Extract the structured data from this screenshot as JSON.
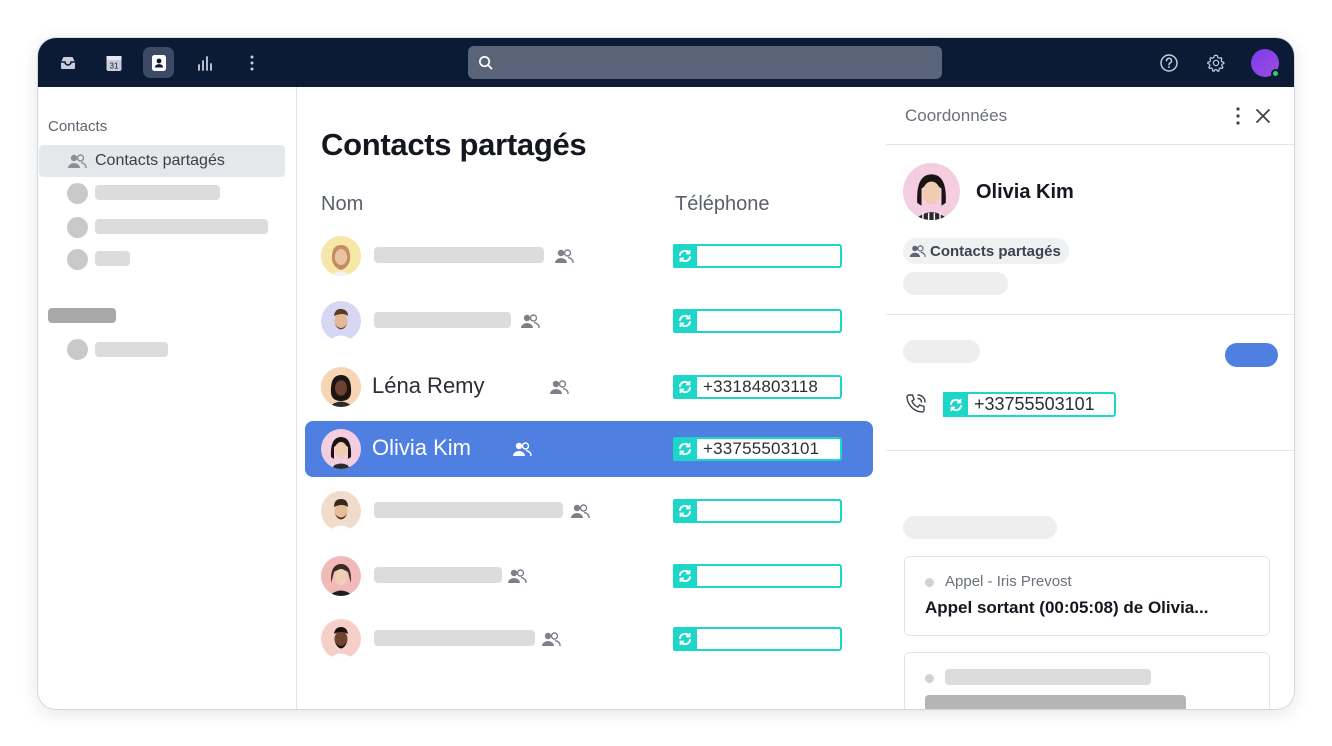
{
  "topbar": {
    "icons": [
      "inbox-icon",
      "calendar-icon",
      "contacts-icon",
      "analytics-icon",
      "more-vertical-icon"
    ],
    "calendar_day": "31",
    "search_placeholder": "",
    "help_icon": "help-icon",
    "settings_icon": "gear-icon"
  },
  "sidebar": {
    "heading": "Contacts",
    "active_item": "Contacts partagés"
  },
  "list": {
    "title": "Contacts partagés",
    "col_name": "Nom",
    "col_phone": "Téléphone",
    "rows": [
      {
        "name": "",
        "phone": "",
        "selected": false
      },
      {
        "name": "",
        "phone": "",
        "selected": false
      },
      {
        "name": "Léna Remy",
        "phone": "+33184803118",
        "selected": false
      },
      {
        "name": "Olivia Kim",
        "phone": "+33755503101",
        "selected": true
      },
      {
        "name": "",
        "phone": "",
        "selected": false
      },
      {
        "name": "",
        "phone": "",
        "selected": false
      },
      {
        "name": "",
        "phone": "",
        "selected": false
      }
    ]
  },
  "details": {
    "title": "Coordonnées",
    "name": "Olivia Kim",
    "group_chip": "Contacts partagés",
    "phone": "+33755503101",
    "activity": {
      "meta": "Appel - Iris Prevost",
      "description": "Appel sortant (00:05:08) de Olivia..."
    }
  },
  "colors": {
    "topbar": "#0b1b36",
    "accent_blue": "#4f7fe0",
    "phone_teal": "#1cd6c8",
    "presence_green": "#2ecc71"
  }
}
